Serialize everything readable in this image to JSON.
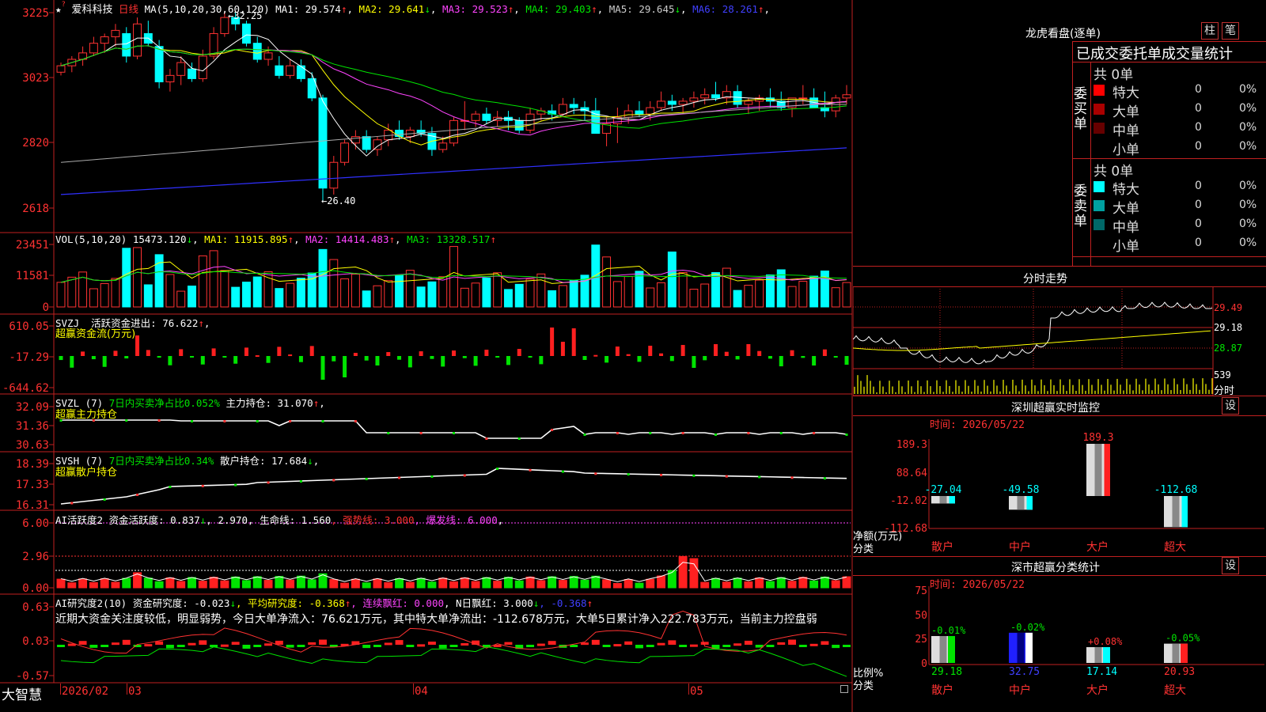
{
  "stock": {
    "name": "爱科科技",
    "period": "日线",
    "star": "★",
    "ma_label": "MA(5,10,20,30,60,120)",
    "ma": [
      {
        "label": "MA1: 29.574",
        "arrow": "↑",
        "color": "#ffffff"
      },
      {
        "label": "MA2: 29.641",
        "arrow": "↓",
        "color": "#ffff00"
      },
      {
        "label": "MA3: 29.523",
        "arrow": "↑",
        "color": "#ff44ff"
      },
      {
        "label": "MA4: 29.403",
        "arrow": "↑",
        "color": "#00e400"
      },
      {
        "label": "MA5: 29.645",
        "arrow": "↓",
        "color": "#cccccc"
      },
      {
        "label": "MA6: 28.261",
        "arrow": "↑",
        "color": "#4040ff"
      }
    ],
    "high_mark": "32.25",
    "low_mark": "26.40",
    "price_ticks": [
      "3225",
      "3023",
      "2820",
      "2618"
    ]
  },
  "vol": {
    "label": "VOL(5,10,20)",
    "value": "15473.120",
    "value_arrow": "↓",
    "ma1": "MA1: 11915.895",
    "ma1_arrow": "↑",
    "ma2": "MA2: 14414.483",
    "ma2_arrow": "↑",
    "ma3": "MA3: 13328.517",
    "ma3_arrow": "↑",
    "ticks": [
      "23451",
      "11581",
      "0"
    ]
  },
  "svzj": {
    "label": "SVZJ",
    "desc": "活跃资金进出: 76.622",
    "arrow": "↑",
    "comma": ",",
    "sub": "超赢资金流(万元)",
    "ticks": [
      "610.05",
      "-17.29",
      "-644.62"
    ]
  },
  "svzl": {
    "label": "SVZL (7)",
    "desc1": "7日内买卖净占比0.052%",
    "desc2": "主力持仓: 31.070",
    "arrow": "↑",
    "comma": ",",
    "sub": "超赢主力持仓",
    "ticks": [
      "32.09",
      "31.36",
      "30.63"
    ]
  },
  "svsh": {
    "label": "SVSH (7)",
    "desc1": "7日内买卖净占比0.34%",
    "desc2": "散户持仓: 17.684",
    "arrow": "↓",
    "comma": ",",
    "sub": "超赢散户持仓",
    "ticks": [
      "18.39",
      "17.33",
      "16.31"
    ]
  },
  "ai_active": {
    "label": "AI活跃度2",
    "desc1": "资金活跃度: 0.837",
    "arrow1": "↓",
    "desc2": ", 2.970",
    "desc3": ", 生命线: 1.560",
    "desc4": ", 强势线: 3.000",
    "desc5": ", 爆发线: 6.000",
    "comma": ",",
    "ticks": [
      "6.00",
      "2.96",
      "0.00"
    ]
  },
  "ai_research": {
    "label": "AI研究度2(10)",
    "desc1": "资金研究度: -0.023",
    "arrow1": "↓",
    "desc2": ", 平均研究度: -0.368",
    "arrow2": "↑",
    "desc3": ", 连续飘红: 0.000",
    "desc4": ", N日飘红: 3.000",
    "arrow4": "↓",
    "desc5": ", -0.368",
    "arrow5": "↑",
    "comment": "近期大资金关注度较低，明显弱势，今日大单净流入：76.621万元，其中特大单净流出：-112.678万元，大单5日累计净入222.783万元，当前主力控盘弱",
    "ticks": [
      "0.63",
      "0.03",
      "-0.57"
    ]
  },
  "footer": {
    "brand": "大智慧",
    "dates": [
      "2026/02",
      "03",
      "04",
      "05"
    ]
  },
  "lhb": {
    "title": "龙虎看盘(逐单)",
    "btn1": "柱",
    "btn2": "笔",
    "subtitle": "已成交委托单成交量统计",
    "buy_label": "委买单",
    "sell_label": "委卖单",
    "buy_total": "共 0单",
    "sell_total": "共 0单",
    "buy_rows": [
      {
        "name": "特大",
        "count": "0",
        "pct": "0%",
        "color": "#ff0000"
      },
      {
        "name": "大单",
        "count": "0",
        "pct": "0%",
        "color": "#aa0000"
      },
      {
        "name": "中单",
        "count": "0",
        "pct": "0%",
        "color": "#660000"
      },
      {
        "name": "小单",
        "count": "0",
        "pct": "0%",
        "color": ""
      }
    ],
    "sell_rows": [
      {
        "name": "特大",
        "count": "0",
        "pct": "0%",
        "color": "#00ffff"
      },
      {
        "name": "大单",
        "count": "0",
        "pct": "0%",
        "color": "#00a0a0"
      },
      {
        "name": "中单",
        "count": "0",
        "pct": "0%",
        "color": "#006868"
      },
      {
        "name": "小单",
        "count": "0",
        "pct": "0%",
        "color": ""
      }
    ]
  },
  "intraday": {
    "title": "分时走势",
    "ticks": [
      "29.49",
      "29.18",
      "28.87"
    ],
    "vol_tick": "539",
    "vol_label": "分时"
  },
  "sz_monitor": {
    "title": "深圳超赢实时监控",
    "btn": "设",
    "time": "时间: 2026/05/22",
    "ylabel": "净额(万元)",
    "xlabel": "分类",
    "ticks": [
      "189.3",
      "88.64",
      "-12.02",
      "-112.68"
    ],
    "bars": [
      {
        "label": "散户",
        "value": "-27.04",
        "label_color": "#ff3232"
      },
      {
        "label": "中户",
        "value": "-49.58",
        "label_color": "#ff3232"
      },
      {
        "label": "大户",
        "value": "189.3",
        "label_color": "#ff3232"
      },
      {
        "label": "超大",
        "value": "-112.68",
        "label_color": "#ff3232"
      }
    ]
  },
  "sz_class": {
    "title": "深市超赢分类统计",
    "btn": "设",
    "time": "时间: 2026/05/22",
    "ylabel": "比例%",
    "xlabel": "分类",
    "ticks": [
      "75",
      "50",
      "25",
      "0"
    ],
    "bars": [
      {
        "label": "散户",
        "value": "29.18",
        "change": "-0.01%",
        "change_color": "#00e400",
        "value_color": "#00e400"
      },
      {
        "label": "中户",
        "value": "32.75",
        "change": "-0.02%",
        "change_color": "#00e400",
        "value_color": "#4040ff"
      },
      {
        "label": "大户",
        "value": "17.14",
        "change": "+0.08%",
        "change_color": "#ff3232",
        "value_color": "#00ffff"
      },
      {
        "label": "超大",
        "value": "20.93",
        "change": "-0.05%",
        "change_color": "#00e400",
        "value_color": "#ff3232"
      }
    ]
  },
  "chart_data": {
    "type": "candlestick",
    "candles": [
      [
        30.4,
        30.7,
        30.3,
        30.6
      ],
      [
        30.6,
        30.9,
        30.4,
        30.8
      ],
      [
        30.8,
        31.2,
        30.6,
        31.0
      ],
      [
        31.0,
        31.5,
        30.9,
        31.3
      ],
      [
        31.3,
        31.6,
        31.0,
        31.5
      ],
      [
        31.5,
        31.9,
        31.2,
        31.7
      ],
      [
        31.6,
        31.8,
        30.7,
        30.9
      ],
      [
        30.9,
        32.1,
        30.8,
        31.9
      ],
      [
        31.6,
        32.0,
        31.2,
        31.3
      ],
      [
        31.2,
        31.4,
        29.9,
        30.1
      ],
      [
        30.1,
        30.5,
        29.8,
        30.3
      ],
      [
        30.3,
        30.9,
        30.0,
        30.7
      ],
      [
        30.5,
        30.7,
        30.1,
        30.2
      ],
      [
        30.2,
        31.1,
        30.1,
        30.9
      ],
      [
        30.9,
        31.8,
        30.8,
        31.6
      ],
      [
        31.6,
        32.3,
        31.5,
        32.1
      ],
      [
        32.1,
        32.25,
        31.7,
        31.9
      ],
      [
        31.9,
        32.0,
        31.2,
        31.3
      ],
      [
        31.3,
        31.5,
        30.7,
        30.8
      ],
      [
        30.8,
        31.2,
        30.6,
        31.0
      ],
      [
        30.6,
        30.9,
        30.2,
        30.3
      ],
      [
        30.3,
        30.8,
        30.2,
        30.6
      ],
      [
        30.6,
        30.8,
        30.1,
        30.2
      ],
      [
        30.2,
        30.4,
        29.5,
        29.6
      ],
      [
        29.6,
        29.7,
        26.4,
        26.8
      ],
      [
        26.8,
        27.8,
        26.6,
        27.6
      ],
      [
        27.6,
        28.3,
        27.5,
        28.2
      ],
      [
        28.2,
        28.6,
        28.0,
        28.4
      ],
      [
        28.4,
        28.6,
        27.9,
        28.0
      ],
      [
        28.0,
        28.4,
        27.8,
        28.3
      ],
      [
        28.3,
        28.8,
        28.1,
        28.6
      ],
      [
        28.6,
        28.9,
        28.3,
        28.4
      ],
      [
        28.4,
        28.7,
        28.2,
        28.6
      ],
      [
        28.6,
        28.9,
        28.4,
        28.5
      ],
      [
        28.5,
        28.7,
        27.8,
        28.0
      ],
      [
        28.0,
        28.4,
        27.9,
        28.2
      ],
      [
        28.2,
        29.0,
        28.1,
        28.9
      ],
      [
        28.9,
        29.5,
        28.6,
        28.9
      ],
      [
        28.9,
        29.2,
        28.7,
        29.1
      ],
      [
        29.1,
        29.3,
        28.8,
        28.9
      ],
      [
        28.9,
        29.2,
        28.7,
        29.0
      ],
      [
        29.0,
        29.2,
        28.6,
        28.9
      ],
      [
        28.9,
        29.0,
        28.5,
        28.6
      ],
      [
        28.6,
        29.3,
        28.5,
        29.1
      ],
      [
        29.1,
        29.3,
        28.9,
        29.2
      ],
      [
        29.2,
        29.4,
        28.9,
        29.1
      ],
      [
        29.1,
        29.6,
        29.0,
        29.4
      ],
      [
        29.4,
        29.6,
        29.1,
        29.3
      ],
      [
        29.3,
        29.5,
        28.9,
        29.2
      ],
      [
        29.2,
        29.6,
        29.0,
        28.5
      ],
      [
        28.5,
        29.0,
        28.1,
        28.8
      ],
      [
        28.8,
        29.3,
        28.2,
        29.0
      ],
      [
        29.0,
        29.4,
        28.8,
        29.2
      ],
      [
        29.2,
        29.5,
        29.0,
        29.1
      ],
      [
        29.1,
        29.5,
        28.9,
        29.3
      ],
      [
        29.3,
        29.8,
        29.2,
        29.5
      ],
      [
        29.5,
        29.7,
        29.2,
        29.4
      ],
      [
        29.4,
        29.6,
        29.1,
        29.5
      ],
      [
        29.5,
        29.8,
        29.3,
        29.6
      ],
      [
        29.6,
        29.9,
        29.4,
        29.7
      ],
      [
        29.7,
        30.1,
        29.5,
        29.6
      ],
      [
        29.6,
        30.0,
        29.4,
        29.8
      ],
      [
        29.8,
        30.0,
        29.3,
        29.4
      ],
      [
        29.4,
        29.6,
        29.1,
        29.5
      ],
      [
        29.5,
        29.7,
        29.2,
        29.6
      ],
      [
        29.6,
        29.9,
        29.3,
        29.5
      ],
      [
        29.5,
        29.8,
        29.2,
        29.3
      ],
      [
        29.3,
        29.6,
        29.0,
        29.6
      ],
      [
        29.6,
        30.0,
        29.4,
        29.6
      ],
      [
        29.6,
        29.9,
        29.3,
        29.3
      ],
      [
        29.3,
        29.8,
        29.0,
        29.2
      ],
      [
        29.2,
        29.7,
        29.0,
        29.6
      ],
      [
        29.6,
        30.0,
        29.4,
        29.7
      ]
    ]
  }
}
